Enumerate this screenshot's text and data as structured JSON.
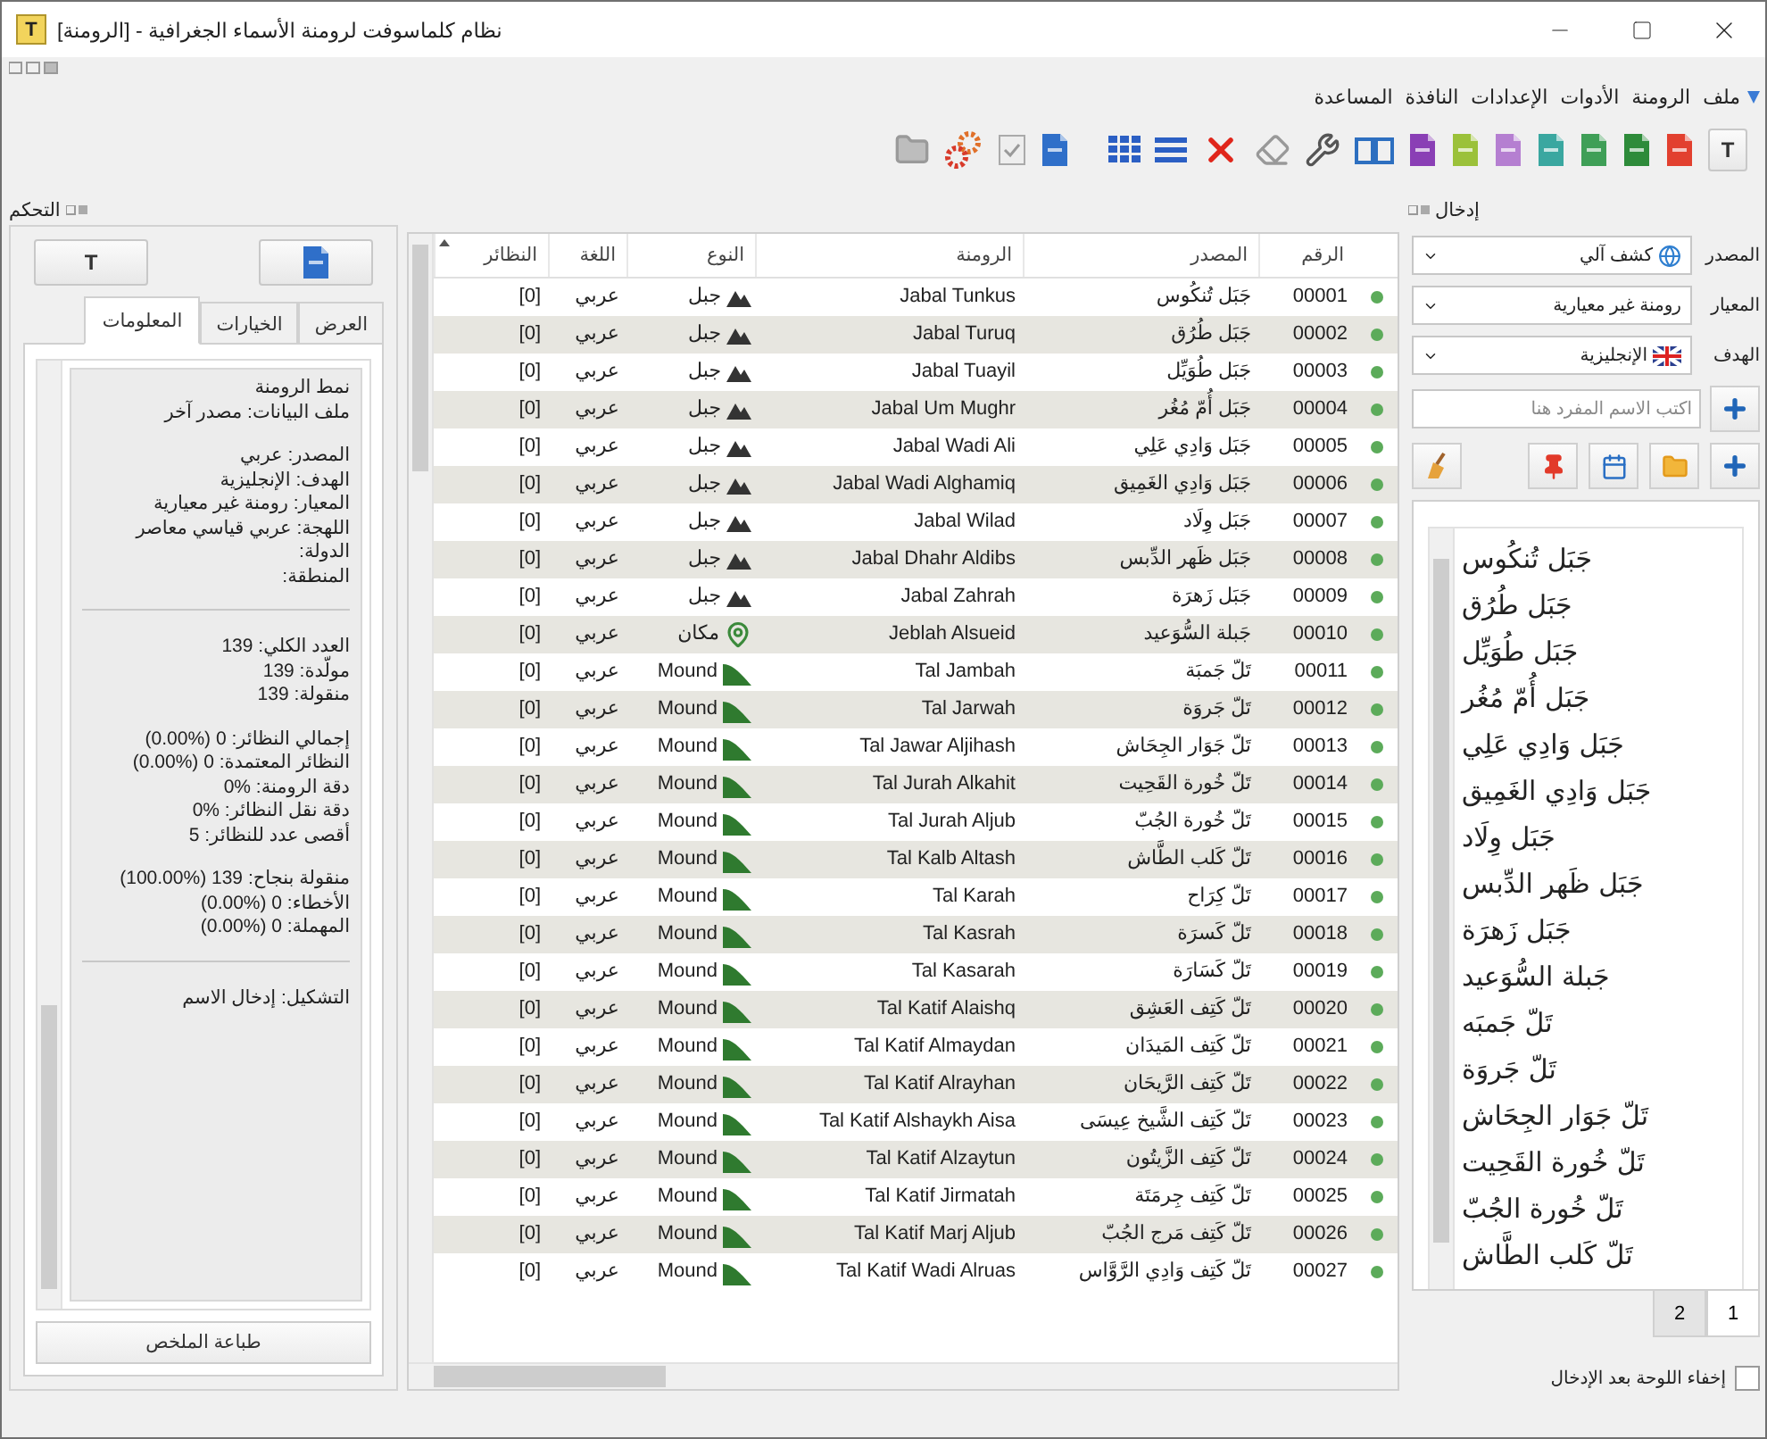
{
  "window": {
    "app_letter": "T",
    "title": "نظام كلماسوفت لرومنة الأسماء الجغرافية - [الرومنة]"
  },
  "menu": [
    "ملف",
    "الرومنة",
    "الأدوات",
    "الإعدادات",
    "النافذة",
    "المساعدة"
  ],
  "toolbar": [
    {
      "kind": "letter",
      "text": "T"
    },
    {
      "kind": "document",
      "color": "#e2402f"
    },
    {
      "kind": "document",
      "color": "#2e8b3a"
    },
    {
      "kind": "document",
      "color": "#3f9f57"
    },
    {
      "kind": "document",
      "color": "#3aa7a0"
    },
    {
      "kind": "document",
      "color": "#b57fd1"
    },
    {
      "kind": "document",
      "color": "#9bc13a"
    },
    {
      "kind": "document",
      "color": "#8a3fb5"
    },
    {
      "kind": "book"
    },
    {
      "kind": "wrench"
    },
    {
      "kind": "eraser"
    },
    {
      "kind": "delete"
    },
    {
      "kind": "list"
    },
    {
      "kind": "grid"
    },
    {
      "kind": "separator"
    },
    {
      "kind": "document",
      "color": "#2f6fc9"
    },
    {
      "kind": "checklist"
    },
    {
      "kind": "gears"
    },
    {
      "kind": "folder"
    }
  ],
  "control_panel": {
    "title": "التحكم",
    "buttons": [
      {
        "kind": "document"
      },
      {
        "kind": "letter",
        "text": "T"
      }
    ],
    "tabs": [
      {
        "label": "العرض",
        "selected": false
      },
      {
        "label": "الخيارات",
        "selected": false
      },
      {
        "label": "المعلومات",
        "selected": true
      }
    ],
    "info_sections": [
      [
        [
          "نمط الرومنة",
          "ملف البيانات: مصدر آخر"
        ],
        [
          "المصدر: عربي",
          "الهدف: الإنجليزية",
          "المعيار: رومنة غير معيارية",
          "اللهجة: عربي قياسي معاصر",
          "الدولة:",
          "المنطقة:"
        ]
      ],
      [
        [
          "العدد الكلي: 139",
          "مولّدة: 139",
          "منقولة: 139"
        ],
        [
          "إجمالي النظائر: 0 (%0.00)",
          "النظائر المعتمدة: 0 (%0.00)",
          "دقة الرومنة: %0",
          "دقة نقل النظائر: %0",
          "أقصى عدد للنظائر: 5"
        ],
        [
          "منقولة بنجاح: 139 (%100.00)",
          "الأخطاء: 0 (%0.00)",
          "المهملة: 0 (%0.00)"
        ]
      ],
      [
        [
          "التشكيل: إدخال الاسم"
        ]
      ]
    ],
    "print_button": "طباعة الملخص"
  },
  "table": {
    "columns": [
      "الرقم",
      "المصدر",
      "الرومنة",
      "النوع",
      "اللغة",
      "النظائر"
    ],
    "rows": [
      {
        "number": "00001",
        "source": "جَبَل تُنكُوس",
        "roman": "Jabal Tunkus",
        "kind": "mountain",
        "type": "جبل",
        "language": "عربي",
        "variants": "[0]"
      },
      {
        "number": "00002",
        "source": "جَبَل طُرُق",
        "roman": "Jabal Turuq",
        "kind": "mountain",
        "type": "جبل",
        "language": "عربي",
        "variants": "[0]"
      },
      {
        "number": "00003",
        "source": "جَبَل طُوَيِّل",
        "roman": "Jabal Tuayil",
        "kind": "mountain",
        "type": "جبل",
        "language": "عربي",
        "variants": "[0]"
      },
      {
        "number": "00004",
        "source": "جَبَل أُمّ مُغُر",
        "roman": "Jabal Um Mughr",
        "kind": "mountain",
        "type": "جبل",
        "language": "عربي",
        "variants": "[0]"
      },
      {
        "number": "00005",
        "source": "جَبَل وَادِي عَلِي",
        "roman": "Jabal Wadi Ali",
        "kind": "mountain",
        "type": "جبل",
        "language": "عربي",
        "variants": "[0]"
      },
      {
        "number": "00006",
        "source": "جَبَل وَادِي الغَمِيق",
        "roman": "Jabal Wadi Alghamiq",
        "kind": "mountain",
        "type": "جبل",
        "language": "عربي",
        "variants": "[0]"
      },
      {
        "number": "00007",
        "source": "جَبَل وِلَاد",
        "roman": "Jabal Wilad",
        "kind": "mountain",
        "type": "جبل",
        "language": "عربي",
        "variants": "[0]"
      },
      {
        "number": "00008",
        "source": "جَبَل ظَهر الدِّبس",
        "roman": "Jabal Dhahr Aldibs",
        "kind": "mountain",
        "type": "جبل",
        "language": "عربي",
        "variants": "[0]"
      },
      {
        "number": "00009",
        "source": "جَبَل زَهرَة",
        "roman": "Jabal Zahrah",
        "kind": "mountain",
        "type": "جبل",
        "language": "عربي",
        "variants": "[0]"
      },
      {
        "number": "00010",
        "source": "جَبلة السُّوَعيد",
        "roman": "Jeblah Alsueid",
        "kind": "place",
        "type": "مكان",
        "language": "عربي",
        "variants": "[0]"
      },
      {
        "number": "00011",
        "source": "تَلّ جَمبَة",
        "roman": "Tal Jambah",
        "kind": "mound",
        "type": "Mound",
        "language": "عربي",
        "variants": "[0]"
      },
      {
        "number": "00012",
        "source": "تَلّ جَروَة",
        "roman": "Tal Jarwah",
        "kind": "mound",
        "type": "Mound",
        "language": "عربي",
        "variants": "[0]"
      },
      {
        "number": "00013",
        "source": "تَلّ جَوَار الجِحَاش",
        "roman": "Tal Jawar Aljihash",
        "kind": "mound",
        "type": "Mound",
        "language": "عربي",
        "variants": "[0]"
      },
      {
        "number": "00014",
        "source": "تَلّ خُورة القَحِيت",
        "roman": "Tal Jurah Alkahit",
        "kind": "mound",
        "type": "Mound",
        "language": "عربي",
        "variants": "[0]"
      },
      {
        "number": "00015",
        "source": "تَلّ خُورة الجُبّ",
        "roman": "Tal Jurah Aljub",
        "kind": "mound",
        "type": "Mound",
        "language": "عربي",
        "variants": "[0]"
      },
      {
        "number": "00016",
        "source": "تَلّ كَلب الطَّاش",
        "roman": "Tal Kalb Altash",
        "kind": "mound",
        "type": "Mound",
        "language": "عربي",
        "variants": "[0]"
      },
      {
        "number": "00017",
        "source": "تَلّ كِرَاح",
        "roman": "Tal Karah",
        "kind": "mound",
        "type": "Mound",
        "language": "عربي",
        "variants": "[0]"
      },
      {
        "number": "00018",
        "source": "تَلّ كَسرَة",
        "roman": "Tal Kasrah",
        "kind": "mound",
        "type": "Mound",
        "language": "عربي",
        "variants": "[0]"
      },
      {
        "number": "00019",
        "source": "تَلّ كَسَارَة",
        "roman": "Tal Kasarah",
        "kind": "mound",
        "type": "Mound",
        "language": "عربي",
        "variants": "[0]"
      },
      {
        "number": "00020",
        "source": "تَلّ كَتِف العَشِق",
        "roman": "Tal Katif Alaishq",
        "kind": "mound",
        "type": "Mound",
        "language": "عربي",
        "variants": "[0]"
      },
      {
        "number": "00021",
        "source": "تَلّ كَتِف المَيدَان",
        "roman": "Tal Katif Almaydan",
        "kind": "mound",
        "type": "Mound",
        "language": "عربي",
        "variants": "[0]"
      },
      {
        "number": "00022",
        "source": "تَلّ كَتِف الرَّيحَان",
        "roman": "Tal Katif Alrayhan",
        "kind": "mound",
        "type": "Mound",
        "language": "عربي",
        "variants": "[0]"
      },
      {
        "number": "00023",
        "source": "تَلّ كَتِف الشَّيخ عِيسَى",
        "roman": "Tal Katif Alshaykh Aisa",
        "kind": "mound",
        "type": "Mound",
        "language": "عربي",
        "variants": "[0]"
      },
      {
        "number": "00024",
        "source": "تَلّ كَتِف الزَّيتُون",
        "roman": "Tal Katif Alzaytun",
        "kind": "mound",
        "type": "Mound",
        "language": "عربي",
        "variants": "[0]"
      },
      {
        "number": "00025",
        "source": "تَلّ كَتِف جِرمَتَة",
        "roman": "Tal Katif Jirmatah",
        "kind": "mound",
        "type": "Mound",
        "language": "عربي",
        "variants": "[0]"
      },
      {
        "number": "00026",
        "source": "تَلّ كَتِف مَرج الجُبّ",
        "roman": "Tal Katif Marj Aljub",
        "kind": "mound",
        "type": "Mound",
        "language": "عربي",
        "variants": "[0]"
      },
      {
        "number": "00027",
        "source": "تَلّ كَتِف وَادِي الرَّوَّاس",
        "roman": "Tal Katif Wadi Alruas",
        "kind": "mound",
        "type": "Mound",
        "language": "عربي",
        "variants": "[0]"
      }
    ]
  },
  "entry_panel": {
    "title": "إدخال",
    "fields": [
      {
        "label": "المصدر",
        "value": "كشف آلي",
        "kind": "globe"
      },
      {
        "label": "المعيار",
        "value": "رومنة غير معيارية",
        "kind": "plain"
      },
      {
        "label": "الهدف",
        "value": "الإنجليزية",
        "kind": "flag"
      }
    ],
    "name_input": {
      "placeholder": "اكتب الاسم المفرد هنا"
    },
    "names": [
      "جَبَل تُنكُوس",
      "جَبَل طُرُق",
      "جَبَل طُوَيِّل",
      "جَبَل أُمّ مُغُر",
      "جَبَل وَادِي عَلِي",
      "جَبَل وَادِي الغَمِيق",
      "جَبَل وِلَاد",
      "جَبَل ظَهر الدِّبس",
      "جَبَل زَهرَة",
      "جَبلة السُّوَعيد",
      "تَلّ جَمبَه",
      "تَلّ جَروَة",
      "تَلّ جَوَار الجِحَاش",
      "تَلّ خُورة القَحِيت",
      "تَلّ خُورة الجُبّ",
      "تَلّ كَلب الطَّاش"
    ],
    "pages": [
      {
        "label": "1",
        "selected": true
      },
      {
        "label": "2",
        "selected": false
      }
    ],
    "hide_after_entry": {
      "label": "إخفاء اللوحة بعد الإدخال",
      "checked": false
    }
  }
}
